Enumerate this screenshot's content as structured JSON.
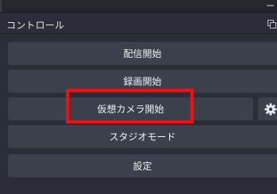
{
  "panel": {
    "title": "コントロール"
  },
  "buttons": {
    "start_streaming": "配信開始",
    "start_recording": "録画開始",
    "start_virtual_camera": "仮想カメラ開始",
    "studio_mode": "スタジオモード",
    "settings": "設定"
  },
  "icons": {
    "virtual_camera_config": "gear-icon",
    "panel_float": "float-window-icon"
  },
  "annotation": {
    "highlight_color": "#ff0a0a",
    "highlight_target": "start_virtual_camera"
  },
  "colors": {
    "panel_bg": "#2b2e38",
    "button_bg": "#3c404d",
    "text": "#f2f2f4"
  }
}
